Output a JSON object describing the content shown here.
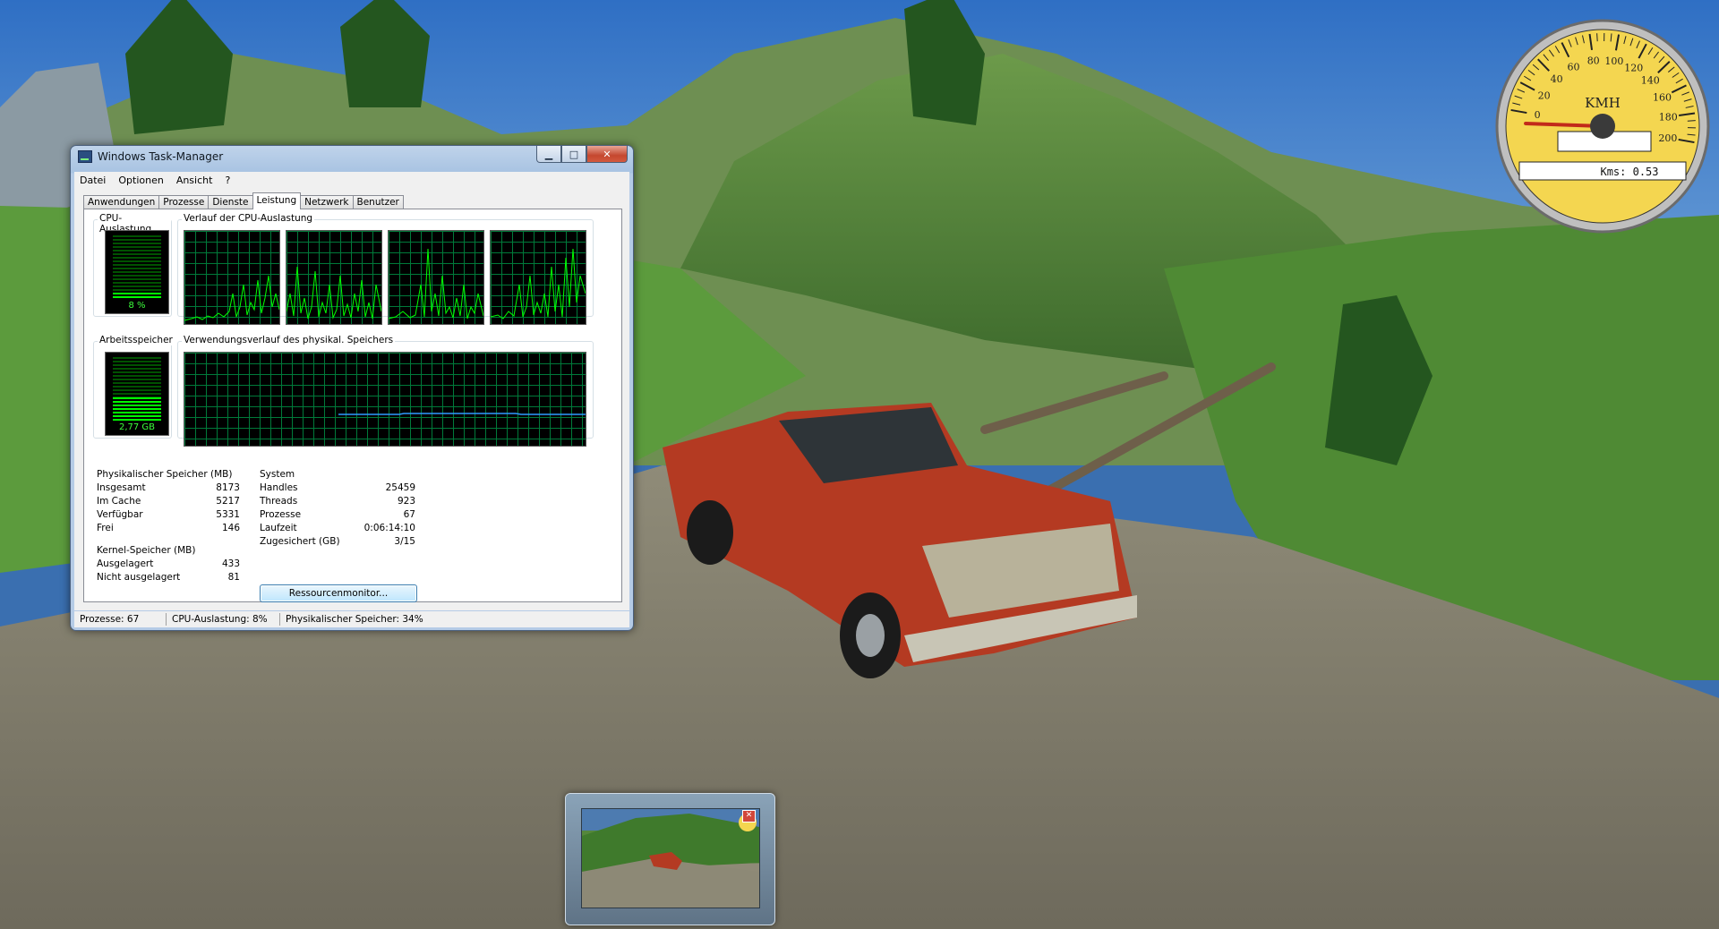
{
  "colors": {
    "sky": "#3f78c2",
    "grass": "#5f9a3c",
    "truck": "#b33a22",
    "gauge_face": "#f4d650",
    "graph_green": "#00ff00",
    "graph_grid": "#007a3a",
    "mem_line": "#2f9bff"
  },
  "task_manager": {
    "title": "Windows Task-Manager",
    "menu": [
      "Datei",
      "Optionen",
      "Ansicht",
      "?"
    ],
    "tabs": [
      {
        "label": "Anwendungen",
        "active": false
      },
      {
        "label": "Prozesse",
        "active": false
      },
      {
        "label": "Dienste",
        "active": false
      },
      {
        "label": "Leistung",
        "active": true
      },
      {
        "label": "Netzwerk",
        "active": false
      },
      {
        "label": "Benutzer",
        "active": false
      }
    ],
    "cpu_usage_label": "CPU-Auslastung",
    "cpu_usage_value": "8 %",
    "cpu_percent": 8,
    "cpu_history_label": "Verlauf der CPU-Auslastung",
    "ram_label": "Arbeitsspeicher",
    "ram_value": "2,77 GB",
    "ram_percent": 34,
    "ram_history_label": "Verwendungsverlauf des physikal. Speichers",
    "physical_memory": {
      "title": "Physikalischer Speicher (MB)",
      "rows": [
        {
          "label": "Insgesamt",
          "value": "8173"
        },
        {
          "label": "Im Cache",
          "value": "5217"
        },
        {
          "label": "Verfügbar",
          "value": "5331"
        },
        {
          "label": "Frei",
          "value": "146"
        }
      ]
    },
    "kernel_memory": {
      "title": "Kernel-Speicher (MB)",
      "rows": [
        {
          "label": "Ausgelagert",
          "value": "433"
        },
        {
          "label": "Nicht ausgelagert",
          "value": "81"
        }
      ]
    },
    "system": {
      "title": "System",
      "rows": [
        {
          "label": "Handles",
          "value": "25459"
        },
        {
          "label": "Threads",
          "value": "923"
        },
        {
          "label": "Prozesse",
          "value": "67"
        },
        {
          "label": "Laufzeit",
          "value": "0:06:14:10"
        },
        {
          "label": "Zugesichert (GB)",
          "value": "3/15"
        }
      ]
    },
    "resource_monitor_button": "Ressourcenmonitor...",
    "status": {
      "processes": "Prozesse: 67",
      "cpu": "CPU-Auslastung: 8%",
      "memory": "Physikalischer Speicher: 34%"
    }
  },
  "speedometer": {
    "unit": "KMH",
    "ticks": [
      "0",
      "20",
      "40",
      "60",
      "80",
      "100",
      "120",
      "140",
      "160",
      "180",
      "200"
    ],
    "speed": 0,
    "odometer": "Kms: 0.53"
  },
  "taskbar_preview": {
    "close_glyph": "✕"
  }
}
